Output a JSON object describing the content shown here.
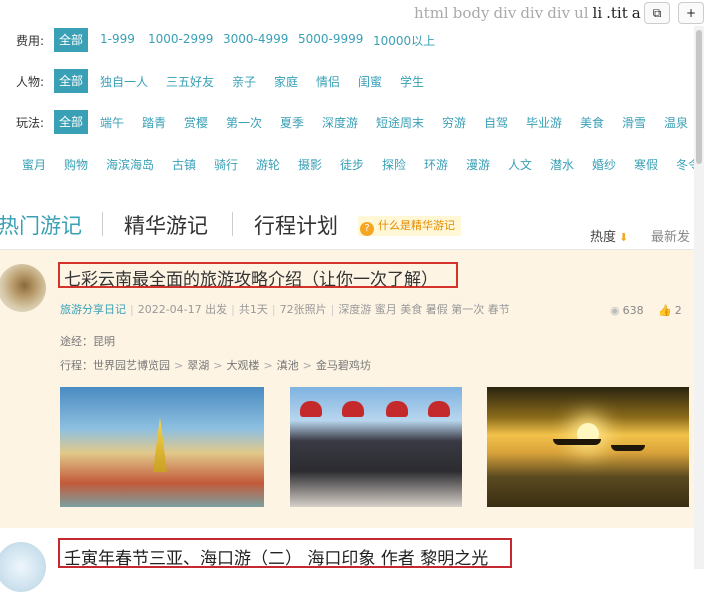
{
  "devtools": {
    "breadcrumb": [
      "html",
      "body",
      "div",
      "div",
      "div",
      "ul",
      "li",
      ".tit",
      "a"
    ],
    "copy_icon": "copy-icon",
    "add_icon": "plus-icon"
  },
  "filters": {
    "cost": {
      "label": "费用:",
      "items": [
        "全部",
        "1-999",
        "1000-2999",
        "3000-4999",
        "5000-9999",
        "10000以上"
      ]
    },
    "people": {
      "label": "人物:",
      "items": [
        "全部",
        "独自一人",
        "三五好友",
        "亲子",
        "家庭",
        "情侣",
        "闺蜜",
        "学生"
      ]
    },
    "play": {
      "label": "玩法:",
      "items": [
        "全部",
        "端午",
        "踏青",
        "赏樱",
        "第一次",
        "夏季",
        "深度游",
        "短途周末",
        "穷游",
        "自驾",
        "毕业游",
        "美食",
        "滑雪",
        "温泉"
      ]
    },
    "play_more": {
      "items": [
        "蜜月",
        "购物",
        "海滨海岛",
        "古镇",
        "骑行",
        "游轮",
        "摄影",
        "徒步",
        "探险",
        "环游",
        "漫游",
        "人文",
        "潜水",
        "婚纱",
        "寒假",
        "冬令"
      ]
    }
  },
  "tabs": {
    "hot": "热门游记",
    "featured": "精华游记",
    "plan": "行程计划",
    "help": "什么是精华游记",
    "help_icon": "?",
    "sort_hot": "热度",
    "sort_hot_arrow": "⬇",
    "sort_new": "最新发"
  },
  "post1": {
    "title": "七彩云南最全面的旅游攻略介绍（让你一次了解）",
    "author": "旅游分享日记",
    "date": "2022-04-17 出发",
    "days": "共1天",
    "photos": "72张照片",
    "tags": "深度游 蜜月 美食 暑假 第一次 春节",
    "views": "638",
    "likes": "2",
    "via_label": "途经：",
    "via": "昆明",
    "route_label": "行程：",
    "route": [
      "世界园艺博览园",
      "翠湖",
      "大观楼",
      "滇池",
      "金马碧鸡坊"
    ],
    "route_arrow": ">",
    "view_icon": "eye-icon",
    "like_icon": "thumbs-up-icon"
  },
  "post2": {
    "title": "壬寅年春节三亚、海口游（二） 海口印象 作者 黎明之光"
  },
  "colors": {
    "accent": "#3aa0b6",
    "card_bg": "#fdf4e4",
    "highlight_border": "#d3332a"
  }
}
